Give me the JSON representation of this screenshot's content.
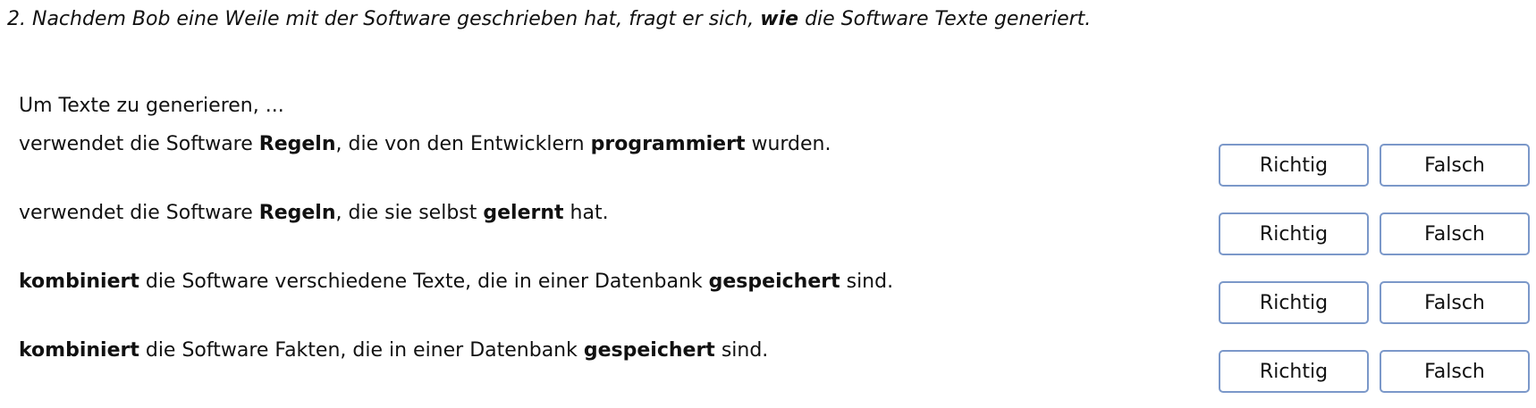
{
  "question": {
    "prefix": "2. Nachdem Bob eine Weile mit der Software geschrieben hat, fragt er sich, ",
    "emphasis": "wie",
    "suffix": " die Software Texte generiert."
  },
  "intro": "Um Texte zu generieren, ...",
  "statements": [
    {
      "parts": [
        {
          "text": "verwendet die Software ",
          "bold": false
        },
        {
          "text": "Regeln",
          "bold": true
        },
        {
          "text": ", die von den Entwicklern ",
          "bold": false
        },
        {
          "text": "programmiert",
          "bold": true
        },
        {
          "text": " wurden.",
          "bold": false
        }
      ],
      "true_label": "Richtig",
      "false_label": "Falsch"
    },
    {
      "parts": [
        {
          "text": "verwendet die Software ",
          "bold": false
        },
        {
          "text": "Regeln",
          "bold": true
        },
        {
          "text": ", die sie selbst ",
          "bold": false
        },
        {
          "text": "gelernt",
          "bold": true
        },
        {
          "text": " hat.",
          "bold": false
        }
      ],
      "true_label": "Richtig",
      "false_label": "Falsch"
    },
    {
      "parts": [
        {
          "text": "kombiniert",
          "bold": true
        },
        {
          "text": " die Software verschiedene Texte, die in einer Datenbank ",
          "bold": false
        },
        {
          "text": "gespeichert",
          "bold": true
        },
        {
          "text": " sind.",
          "bold": false
        }
      ],
      "true_label": "Richtig",
      "false_label": "Falsch"
    },
    {
      "parts": [
        {
          "text": "kombiniert",
          "bold": true
        },
        {
          "text": " die Software Fakten, die in einer Datenbank ",
          "bold": false
        },
        {
          "text": "gespeichert",
          "bold": true
        },
        {
          "text": " sind.",
          "bold": false
        }
      ],
      "true_label": "Richtig",
      "false_label": "Falsch"
    }
  ],
  "colors": {
    "button_border": "#7b98c9",
    "text": "#111111",
    "background": "#ffffff"
  }
}
